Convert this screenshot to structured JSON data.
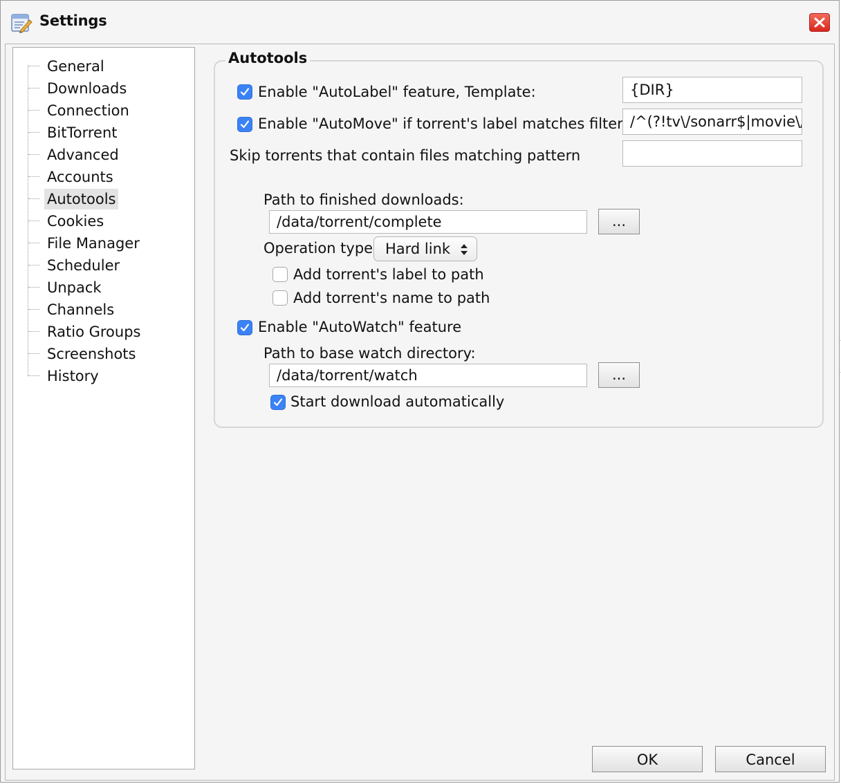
{
  "window": {
    "title": "Settings",
    "icon": "settings-wrench-icon",
    "close_icon": "close-x-icon"
  },
  "sidebar": {
    "items": [
      {
        "label": "General"
      },
      {
        "label": "Downloads"
      },
      {
        "label": "Connection"
      },
      {
        "label": "BitTorrent"
      },
      {
        "label": "Advanced"
      },
      {
        "label": "Accounts"
      },
      {
        "label": "Autotools",
        "selected": true
      },
      {
        "label": "Cookies"
      },
      {
        "label": "File Manager"
      },
      {
        "label": "Scheduler"
      },
      {
        "label": "Unpack"
      },
      {
        "label": "Channels"
      },
      {
        "label": "Ratio Groups"
      },
      {
        "label": "Screenshots"
      },
      {
        "label": "History"
      }
    ]
  },
  "autotools": {
    "group_title": "Autotools",
    "autolabel": {
      "checked": true,
      "label": "Enable \"AutoLabel\" feature, Template:",
      "value": "{DIR}"
    },
    "automove": {
      "checked": true,
      "label": "Enable \"AutoMove\" if torrent's label matches filter",
      "value": "/^(?!tv\\/sonarr$|movie\\/"
    },
    "skip": {
      "label": "Skip torrents that contain files matching pattern",
      "value": ""
    },
    "finished_path": {
      "label": "Path to finished downloads:",
      "value": "/data/torrent/complete",
      "browse_label": "..."
    },
    "operation": {
      "label": "Operation type:",
      "value": "Hard link"
    },
    "add_label_to_path": {
      "checked": false,
      "label": "Add torrent's label to path"
    },
    "add_name_to_path": {
      "checked": false,
      "label": "Add torrent's name to path"
    },
    "autowatch": {
      "checked": true,
      "label": "Enable \"AutoWatch\" feature"
    },
    "watch_path": {
      "label": "Path to base watch directory:",
      "value": "/data/torrent/watch",
      "browse_label": "..."
    },
    "start_auto": {
      "checked": true,
      "label": "Start download automatically"
    }
  },
  "footer": {
    "ok_label": "OK",
    "cancel_label": "Cancel"
  },
  "colors": {
    "accent": "#3b82f6",
    "close_red": "#d9281b"
  }
}
